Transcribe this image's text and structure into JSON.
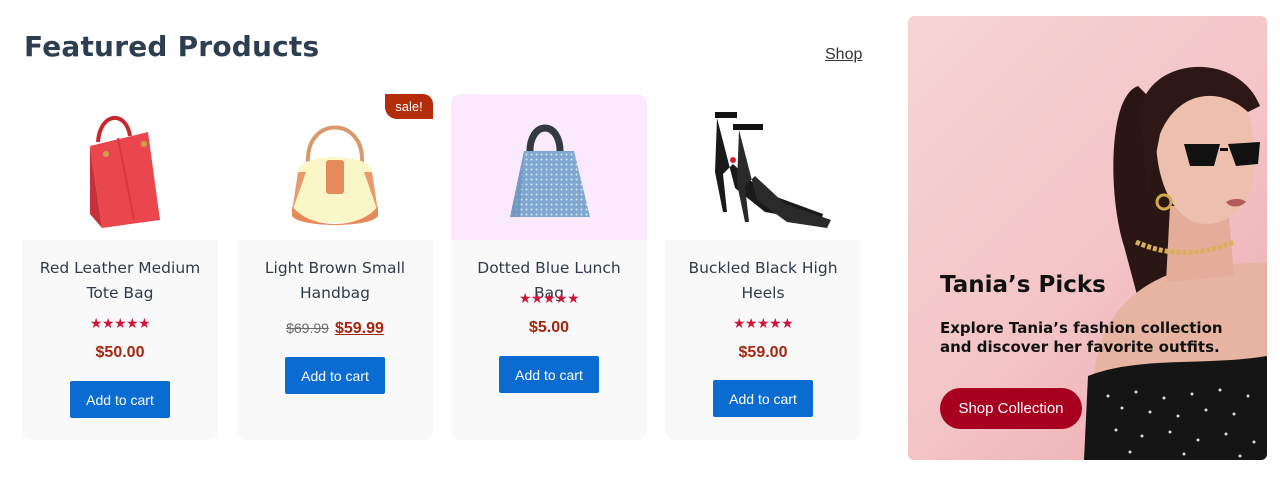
{
  "section": {
    "title": "Featured Products",
    "shop_link": "Shop"
  },
  "products": [
    {
      "name": "Red Leather Medium Tote Bag",
      "rating": "★★★★★",
      "price": "$50.00",
      "button": "Add to cart",
      "image": "red-tote-bag"
    },
    {
      "name": "Light Brown Small Handbag",
      "rating": "",
      "old_price": "$69.99",
      "price": "$59.99",
      "button": "Add to cart",
      "badge": "sale!",
      "image": "light-brown-handbag"
    },
    {
      "name": "Dotted Blue Lunch Bag",
      "rating": "★★★★★",
      "price": "$5.00",
      "button": "Add to cart",
      "image": "blue-lunch-bag"
    },
    {
      "name": "Buckled Black High Heels",
      "rating": "★★★★★",
      "price": "$59.00",
      "button": "Add to cart",
      "image": "black-high-heels"
    }
  ],
  "promo": {
    "title": "Tania’s Picks",
    "text": "Explore Tania’s fashion collection and discover her favorite outfits.",
    "button": "Shop Collection"
  },
  "colors": {
    "button_blue": "#0a6bd1",
    "price_red": "#a4260e",
    "star_red": "#d0143a",
    "promo_button": "#a8001f",
    "sale_badge": "#b32d0a"
  }
}
